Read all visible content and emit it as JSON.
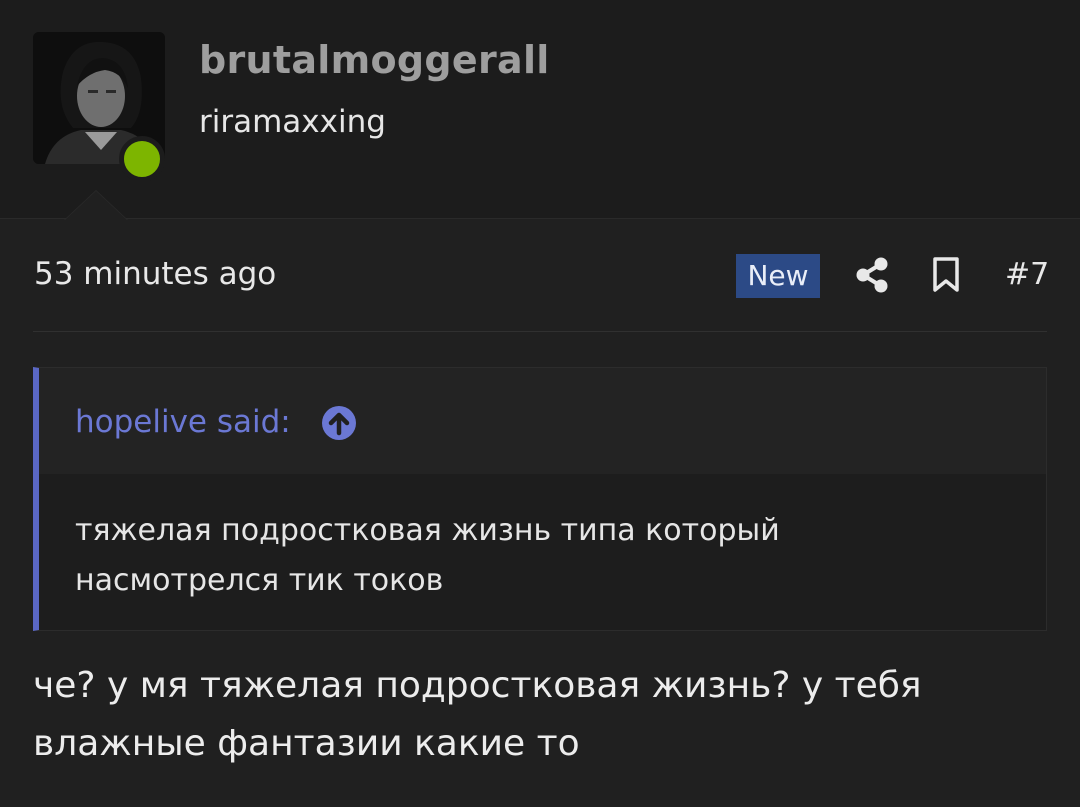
{
  "user": {
    "username": "brutalmoggerall",
    "title": "riramaxxing",
    "online_status_color": "#7db500"
  },
  "post": {
    "time": "53 minutes ago",
    "badge": "New",
    "number": "#7",
    "share_icon": "share-icon",
    "bookmark_icon": "bookmark-icon"
  },
  "quote": {
    "author_label": "hopelive said:",
    "jump_icon": "arrow-up-circle-icon",
    "lines": [
      "тяжелая подростковая жизнь типа который",
      "насмотрелся тик токов"
    ]
  },
  "message": {
    "lines": [
      "че? у мя тяжелая подростковая жизнь? у тебя",
      "влажные фантазии какие то"
    ]
  },
  "colors": {
    "background": "#202020",
    "header_background": "#1c1c1c",
    "badge_new": "#2c4a86",
    "quote_accent": "#5a67c4",
    "quote_author": "#6b78d4"
  }
}
